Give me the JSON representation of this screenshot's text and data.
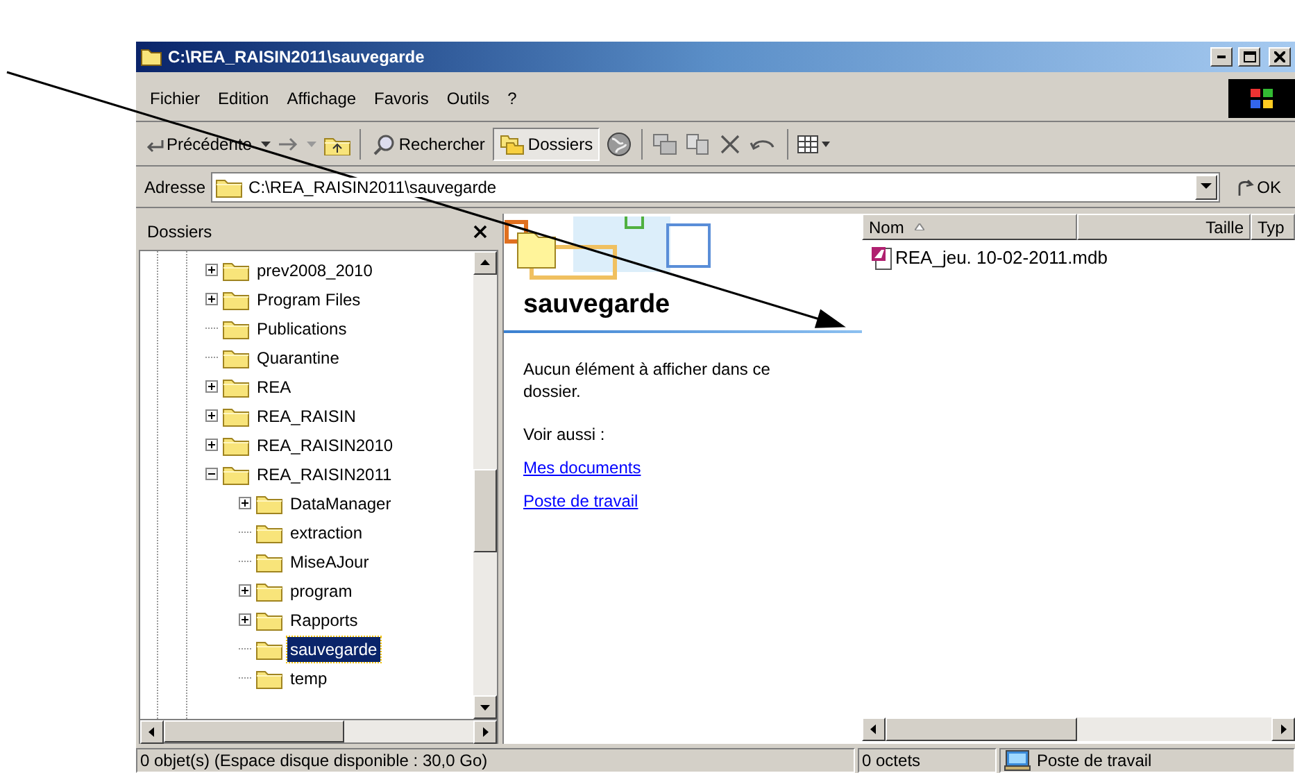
{
  "window": {
    "title": "C:\\REA_RAISIN2011\\sauvegarde"
  },
  "menu": [
    "Fichier",
    "Edition",
    "Affichage",
    "Favoris",
    "Outils",
    "?"
  ],
  "toolbar": {
    "back": "Précédente",
    "search": "Rechercher",
    "folders": {
      "label": "Dossiers",
      "pressed": true
    }
  },
  "address": {
    "label": "Adresse",
    "value": "C:\\REA_RAISIN2011\\sauvegarde",
    "go": "OK"
  },
  "folders_pane": {
    "title": "Dossiers",
    "tree": [
      {
        "label": "prev2008_2010",
        "kind": "expandable",
        "expanded": false,
        "selected": false
      },
      {
        "label": "Program Files",
        "kind": "expandable",
        "expanded": false,
        "selected": false
      },
      {
        "label": "Publications",
        "kind": "leaf",
        "selected": false
      },
      {
        "label": "Quarantine",
        "kind": "leaf",
        "selected": false
      },
      {
        "label": "REA",
        "kind": "expandable",
        "expanded": false,
        "selected": false
      },
      {
        "label": "REA_RAISIN",
        "kind": "expandable",
        "expanded": false,
        "selected": false
      },
      {
        "label": "REA_RAISIN2010",
        "kind": "expandable",
        "expanded": false,
        "selected": false
      },
      {
        "label": "REA_RAISIN2011",
        "kind": "expandable",
        "expanded": true,
        "selected": false,
        "children": [
          {
            "label": "DataManager",
            "kind": "expandable",
            "expanded": false,
            "selected": false
          },
          {
            "label": "extraction",
            "kind": "leaf",
            "selected": false
          },
          {
            "label": "MiseAJour",
            "kind": "leaf",
            "selected": false
          },
          {
            "label": "program",
            "kind": "expandable",
            "expanded": false,
            "selected": false
          },
          {
            "label": "Rapports",
            "kind": "expandable",
            "expanded": false,
            "selected": false
          },
          {
            "label": "sauvegarde",
            "kind": "leaf",
            "selected": true
          },
          {
            "label": "temp",
            "kind": "leaf",
            "selected": false
          }
        ]
      }
    ]
  },
  "web_view": {
    "heading": "sauvegarde",
    "message": "Aucun élément à afficher dans ce dossier.",
    "see_also": "Voir aussi :",
    "links": [
      "Mes documents",
      "Poste de travail"
    ]
  },
  "file_list": {
    "columns": [
      {
        "label": "Nom",
        "sorted": true
      },
      {
        "label": "Taille",
        "sorted": false
      },
      {
        "label": "Typ",
        "sorted": false
      }
    ],
    "files": [
      {
        "name": "REA_jeu. 10-02-2011.mdb"
      }
    ]
  },
  "status_bar": [
    "0 objet(s) (Espace disque disponible : 30,0 Go)",
    "0 octets",
    "Poste de travail"
  ]
}
